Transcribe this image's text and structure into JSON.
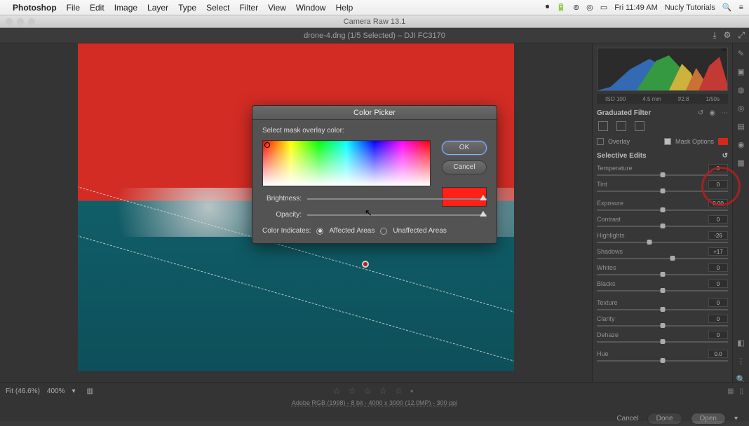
{
  "menubar": {
    "app": "Photoshop",
    "items": [
      "File",
      "Edit",
      "Image",
      "Layer",
      "Type",
      "Select",
      "Filter",
      "View",
      "Window",
      "Help"
    ],
    "clock": "Fri 11:49 AM",
    "user": "Nucly Tutorials"
  },
  "titlebar": {
    "title": "Camera Raw 13.1"
  },
  "doc": {
    "title": "drone-4.dng (1/5 Selected) – DJI FC3170"
  },
  "footer": {
    "fit": "Fit (46.6%)",
    "zoom": "400%",
    "info": "Adobe RGB (1998) - 8 bit - 4000 x 3000 (12.0MP) - 300 ppi",
    "cancel": "Cancel",
    "done": "Done",
    "open": "Open"
  },
  "panel": {
    "meta": [
      "ISO 100",
      "4.5 mm",
      "f/2.8",
      "1/50s"
    ],
    "title": "Graduated Filter",
    "overlay": "Overlay",
    "maskopts": "Mask Options",
    "section": "Selective Edits",
    "sliders": [
      {
        "label": "Temperature",
        "val": "0",
        "pos": 50
      },
      {
        "label": "Tint",
        "val": "0",
        "pos": 50
      },
      {
        "label": "Exposure",
        "val": "0.00",
        "pos": 50
      },
      {
        "label": "Contrast",
        "val": "0",
        "pos": 50
      },
      {
        "label": "Highlights",
        "val": "-26",
        "pos": 40
      },
      {
        "label": "Shadows",
        "val": "+17",
        "pos": 58
      },
      {
        "label": "Whites",
        "val": "0",
        "pos": 50
      },
      {
        "label": "Blacks",
        "val": "0",
        "pos": 50
      },
      {
        "label": "Texture",
        "val": "0",
        "pos": 50
      },
      {
        "label": "Clarity",
        "val": "0",
        "pos": 50
      },
      {
        "label": "Dehaze",
        "val": "0",
        "pos": 50
      },
      {
        "label": "Hue",
        "val": "0.0",
        "pos": 50
      }
    ]
  },
  "modal": {
    "title": "Color Picker",
    "select": "Select mask overlay color:",
    "ok": "OK",
    "cancel": "Cancel",
    "brightness": "Brightness:",
    "opacity": "Opacity:",
    "indicates": "Color Indicates:",
    "affected": "Affected Areas",
    "unaffected": "Unaffected Areas"
  }
}
